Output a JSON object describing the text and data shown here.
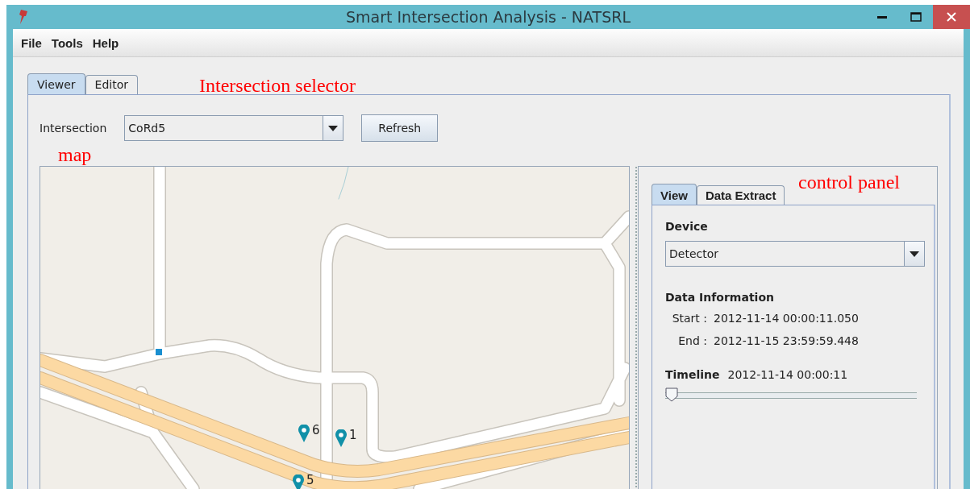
{
  "window": {
    "title": "Smart Intersection Analysis - NATSRL"
  },
  "menu": [
    "File",
    "Tools",
    "Help"
  ],
  "tabs": [
    {
      "label": "Viewer",
      "selected": true
    },
    {
      "label": "Editor",
      "selected": false
    }
  ],
  "intersection": {
    "label": "Intersection",
    "value": "CoRd5",
    "refresh": "Refresh"
  },
  "map": {
    "markers": [
      {
        "label": "6"
      },
      {
        "label": "1"
      },
      {
        "label": "5"
      }
    ]
  },
  "control_panel": {
    "tabs": [
      {
        "label": "View",
        "selected": true
      },
      {
        "label": "Data Extract",
        "selected": false
      }
    ],
    "device_label": "Device",
    "device": "Detector",
    "info_title": "Data Information",
    "info": [
      {
        "label": "Start :",
        "value": "2012-11-14 00:00:11.050"
      },
      {
        "label": "End :",
        "value": "2012-11-15 23:59:59.448"
      }
    ],
    "timeline_label": "Timeline",
    "timeline_value": "2012-11-14 00:00:11",
    "level": 0
  },
  "annotations": [
    {
      "text": "Intersection selector"
    },
    {
      "text": "map"
    },
    {
      "text": "control panel"
    }
  ]
}
